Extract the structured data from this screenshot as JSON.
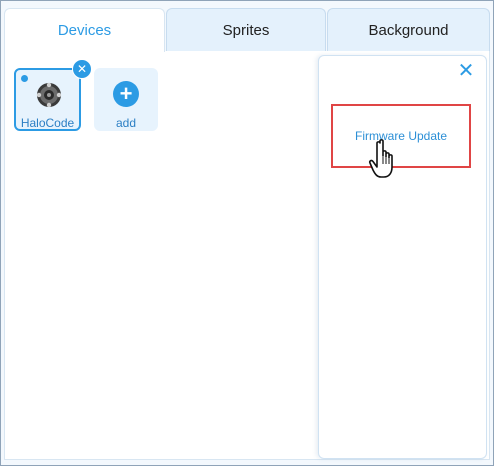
{
  "tabs": {
    "devices": "Devices",
    "sprites": "Sprites",
    "background": "Background"
  },
  "devices": [
    {
      "label": "HaloCode"
    }
  ],
  "add_card": {
    "label": "add"
  },
  "panel": {
    "menu_items": [
      {
        "label": "Firmware Update"
      }
    ]
  },
  "colors": {
    "accent": "#2c9be4",
    "highlight_border": "#e04545",
    "tab_inactive_bg": "#e4f1fc"
  },
  "icons": {
    "remove": "close-icon",
    "add": "plus-icon",
    "panel_close": "close-icon",
    "cursor": "hand-pointer-icon"
  }
}
